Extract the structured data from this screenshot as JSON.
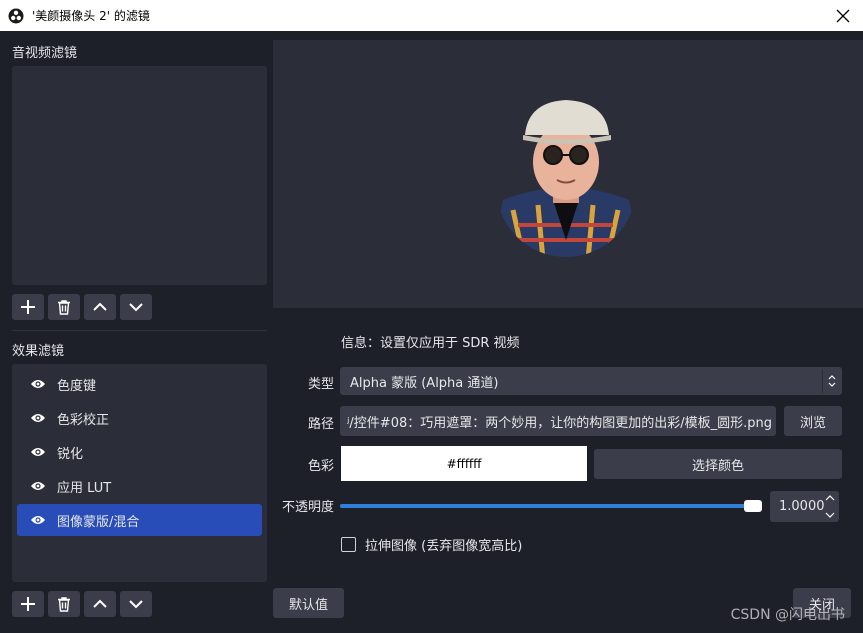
{
  "window": {
    "title": "'美颜摄像头 2' 的滤镜",
    "app_icon": "obs-icon",
    "close_icon": "close-icon"
  },
  "audio_video_filters": {
    "label": "音视频滤镜"
  },
  "effect_filters": {
    "label": "效果滤镜",
    "items": [
      {
        "label": "色度键",
        "visible": true,
        "selected": false
      },
      {
        "label": "色彩校正",
        "visible": true,
        "selected": false
      },
      {
        "label": "锐化",
        "visible": true,
        "selected": false
      },
      {
        "label": "应用 LUT",
        "visible": true,
        "selected": false
      },
      {
        "label": "图像蒙版/混合",
        "visible": true,
        "selected": true
      }
    ]
  },
  "toolbar_icons": {
    "add": "plus-icon",
    "remove": "trash-icon",
    "up": "chevron-up-icon",
    "down": "chevron-down-icon"
  },
  "properties": {
    "info": "信息：设置仅应用于 SDR 视频",
    "type_label": "类型",
    "type_value": "Alpha 蒙版 (Alpha 通道)",
    "path_label": "路径",
    "path_value": "ʲ/控件#08：巧用遮罩：两个妙用，让你的构图更加的出彩/模板_圆形.png",
    "browse_label": "浏览",
    "color_label": "色彩",
    "color_value": "#ffffff",
    "pick_color_label": "选择颜色",
    "opacity_label": "不透明度",
    "opacity_value": "1.0000",
    "opacity_fraction": 1.0,
    "stretch_label": "拉伸图像 (丢弃图像宽高比)",
    "stretch_checked": false
  },
  "footer": {
    "defaults_label": "默认值",
    "close_label": "关闭"
  },
  "watermark": "CSDN @闪电出书",
  "colors": {
    "background": "#1e2029",
    "panel": "#2b2e38",
    "button": "#3b3e4a",
    "selected": "#284cb8",
    "slider_fill": "#2f7fd8"
  }
}
